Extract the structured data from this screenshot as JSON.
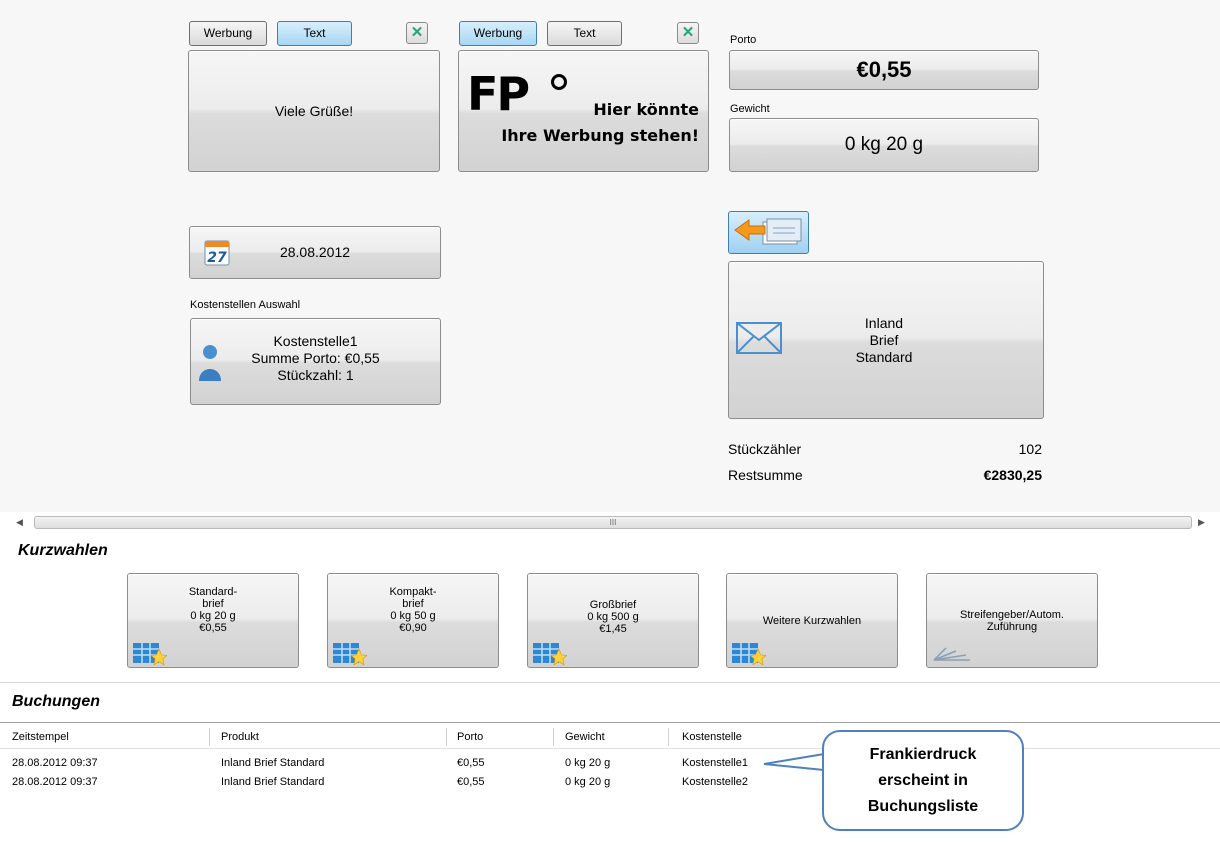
{
  "tabs_left": {
    "werbung": "Werbung",
    "text": "Text"
  },
  "tabs_right": {
    "werbung": "Werbung",
    "text": "Text"
  },
  "text_panel": {
    "message": "Viele Grüße!"
  },
  "ad_panel": {
    "logo": "FP",
    "line1": "Hier könnte",
    "line2": "Ihre Werbung stehen!"
  },
  "porto": {
    "label": "Porto",
    "value": "€0,55"
  },
  "gewicht": {
    "label": "Gewicht",
    "value": "0 kg 20 g"
  },
  "date_button": {
    "value": "28.08.2012",
    "icon_day": "27"
  },
  "kostenstelle": {
    "label": "Kostenstellen Auswahl",
    "name": "Kostenstelle1",
    "summe": "Summe Porto: €0,55",
    "stueck": "Stückzahl: 1"
  },
  "product": {
    "line1": "Inland",
    "line2": "Brief",
    "line3": "Standard"
  },
  "counters": {
    "stueck_label": "Stückzähler",
    "stueck_value": "102",
    "rest_label": "Restsumme",
    "rest_value": "€2830,25"
  },
  "scrollbar": {
    "grip": "III"
  },
  "kurzwahlen": {
    "title": "Kurzwahlen",
    "items": [
      {
        "l1": "Standard-",
        "l2": "brief",
        "l3": "0 kg 20 g",
        "l4": "€0,55",
        "icon": "postage-grid-star-icon"
      },
      {
        "l1": "Kompakt-",
        "l2": "brief",
        "l3": "0 kg 50 g",
        "l4": "€0,90",
        "icon": "postage-grid-star-icon"
      },
      {
        "l1": "Großbrief",
        "l2": "0 kg 500 g",
        "l3": "€1,45",
        "l4": "",
        "icon": "postage-grid-star-icon"
      },
      {
        "l1": "Weitere Kurzwahlen",
        "l2": "",
        "l3": "",
        "l4": "",
        "icon": "postage-grid-star-icon"
      },
      {
        "l1": "Streifengeber/Autom.",
        "l2": "Zuführung",
        "l3": "",
        "l4": "",
        "icon": "stripe-feeder-icon"
      }
    ]
  },
  "buchungen": {
    "title": "Buchungen",
    "columns": [
      "Zeitstempel",
      "Produkt",
      "Porto",
      "Gewicht",
      "Kostenstelle"
    ],
    "rows": [
      [
        "28.08.2012 09:37",
        "Inland Brief Standard",
        "€0,55",
        "0 kg 20 g",
        "Kostenstelle1"
      ],
      [
        "28.08.2012 09:37",
        "Inland Brief Standard",
        "€0,55",
        "0 kg 20 g",
        "Kostenstelle2"
      ]
    ]
  },
  "callout": {
    "l1": "Frankierdruck",
    "l2": "erscheint in",
    "l3": "Buchungsliste"
  },
  "colors": {
    "accent": "#4f81bd",
    "tab_active": "#bfe3f7"
  }
}
